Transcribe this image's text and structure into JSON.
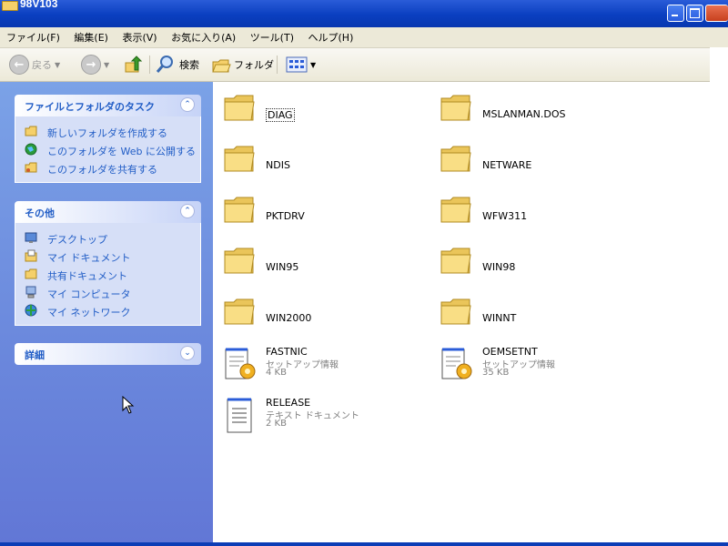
{
  "window": {
    "title": "98V103"
  },
  "menu": [
    "ファイル(F)",
    "編集(E)",
    "表示(V)",
    "お気に入り(A)",
    "ツール(T)",
    "ヘルプ(H)"
  ],
  "toolbar": {
    "back_label": "戻る",
    "search_label": "検索",
    "folders_label": "フォルダ"
  },
  "tasks_panel": {
    "title": "ファイルとフォルダのタスク",
    "items": [
      "新しいフォルダを作成する",
      "このフォルダを Web に公開する",
      "このフォルダを共有する"
    ]
  },
  "other_panel": {
    "title": "その他",
    "items": [
      "デスクトップ",
      "マイ ドキュメント",
      "共有ドキュメント",
      "マイ コンピュータ",
      "マイ ネットワーク"
    ]
  },
  "details_panel": {
    "title": "詳細"
  },
  "folders": [
    "DIAG",
    "MSLANMAN.DOS",
    "NDIS",
    "NETWARE",
    "PKTDRV",
    "WFW311",
    "WIN95",
    "WIN98",
    "WIN2000",
    "WINNT"
  ],
  "files": [
    {
      "name": "FASTNIC",
      "type": "セットアップ情報",
      "size": "4 KB"
    },
    {
      "name": "OEMSETNT",
      "type": "セットアップ情報",
      "size": "35 KB"
    },
    {
      "name": "RELEASE",
      "type": "テキスト ドキュメント",
      "size": "2 KB"
    }
  ],
  "colors": {
    "titlebar": "#0a3fc0",
    "leftpane": "#6a87dc",
    "panel_title": "#215dc6",
    "folder": "#f5d06a"
  }
}
